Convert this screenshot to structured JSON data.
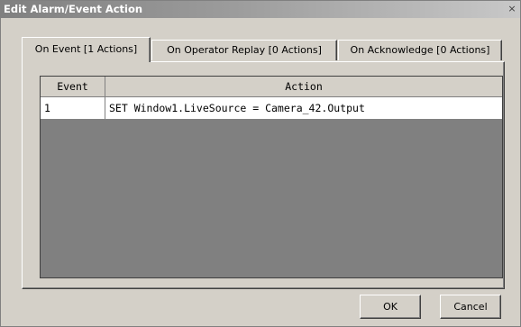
{
  "window": {
    "title": "Edit Alarm/Event Action",
    "close_glyph": "×"
  },
  "tabs": [
    {
      "label": "On Event [1 Actions]",
      "active": true
    },
    {
      "label": "On Operator Replay [0 Actions]",
      "active": false
    },
    {
      "label": "On Acknowledge [0 Actions]",
      "active": false
    }
  ],
  "grid": {
    "columns": [
      "Event",
      "Action"
    ],
    "rows": [
      {
        "event": "1",
        "action": "SET Window1.LiveSource = Camera_42.Output"
      }
    ]
  },
  "buttons": {
    "ok": "OK",
    "cancel": "Cancel"
  },
  "colors": {
    "face": "#d4d0c8",
    "grid_empty": "#808080",
    "titlebar_start": "#808080",
    "titlebar_end": "#c8c8c8"
  }
}
